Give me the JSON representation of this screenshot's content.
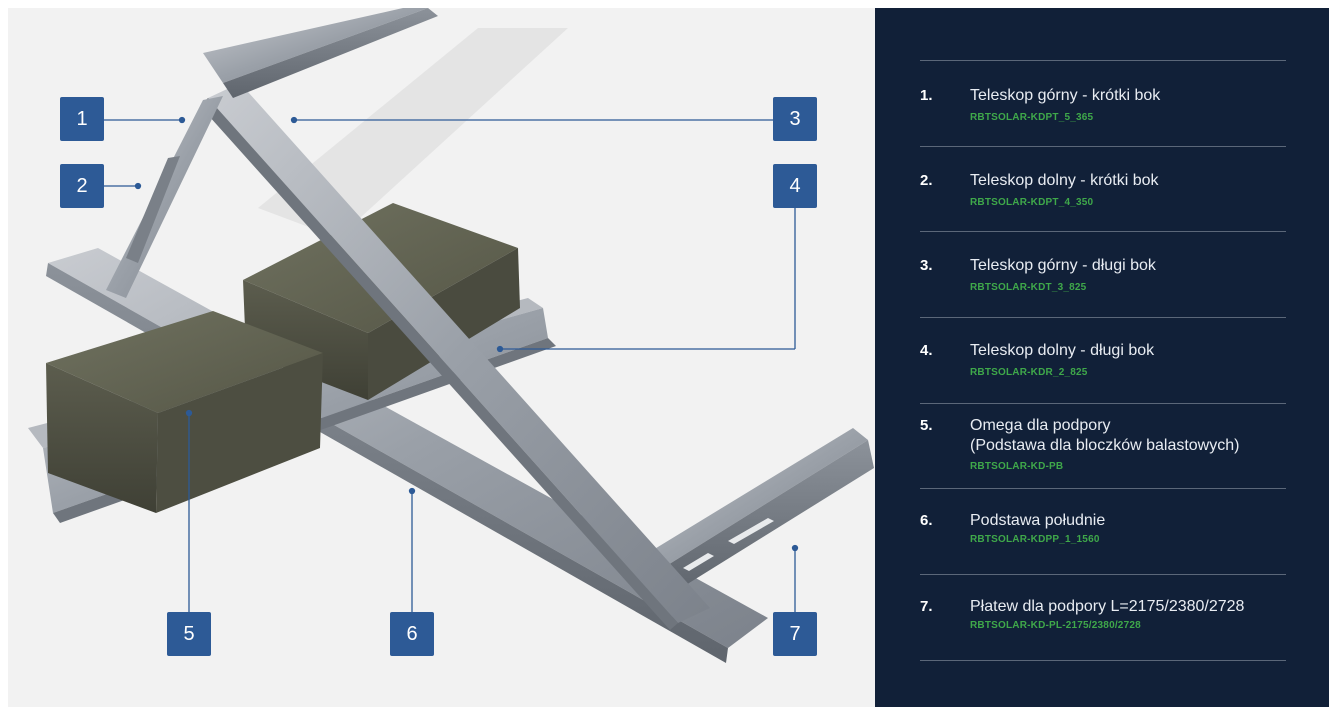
{
  "callouts": [
    {
      "label": "1"
    },
    {
      "label": "2"
    },
    {
      "label": "3"
    },
    {
      "label": "4"
    },
    {
      "label": "5"
    },
    {
      "label": "6"
    },
    {
      "label": "7"
    }
  ],
  "parts": [
    {
      "number": "1.",
      "title": "Teleskop górny - krótki bok",
      "code": "RBTSOLAR-KDPT_5_365"
    },
    {
      "number": "2.",
      "title": "Teleskop dolny - krótki bok",
      "code": "RBTSOLAR-KDPT_4_350"
    },
    {
      "number": "3.",
      "title": "Teleskop górny - długi bok",
      "code": "RBTSOLAR-KDT_3_825"
    },
    {
      "number": "4.",
      "title": "Teleskop dolny - długi bok",
      "code": "RBTSOLAR-KDR_2_825"
    },
    {
      "number": "5.",
      "title": "Omega dla podpory\n(Podstawa dla bloczków balastowych)",
      "code": "RBTSOLAR-KD-PB"
    },
    {
      "number": "6.",
      "title": "Podstawa południe",
      "code": "RBTSOLAR-KDPP_1_1560"
    },
    {
      "number": "7.",
      "title": "Płatew dla podpory L=2175/2380/2728",
      "code": "RBTSOLAR-KD-PL-2175/2380/2728"
    }
  ],
  "colors": {
    "panel_bg": "#112038",
    "badge_bg": "#2d5a96",
    "code_green": "#3fa84a",
    "leader_line": "#2d5a96"
  }
}
